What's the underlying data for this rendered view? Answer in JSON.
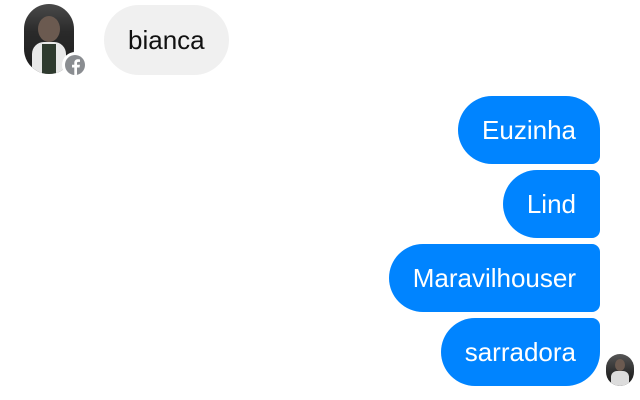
{
  "conversation": {
    "incoming": {
      "sender_avatar_icon": "user-avatar-icon",
      "platform_badge_icon": "facebook-icon",
      "messages": [
        {
          "text": "bianca"
        }
      ]
    },
    "outgoing": {
      "messages": [
        {
          "text": "Euzinha"
        },
        {
          "text": "Lind"
        },
        {
          "text": "Maravilhouser"
        },
        {
          "text": "sarradora"
        }
      ],
      "seen_indicator_icon": "seen-avatar-icon"
    }
  },
  "colors": {
    "outgoing_bubble": "#0084ff",
    "incoming_bubble": "#f0f0f0",
    "background": "#ffffff",
    "badge": "#8a8d91"
  }
}
